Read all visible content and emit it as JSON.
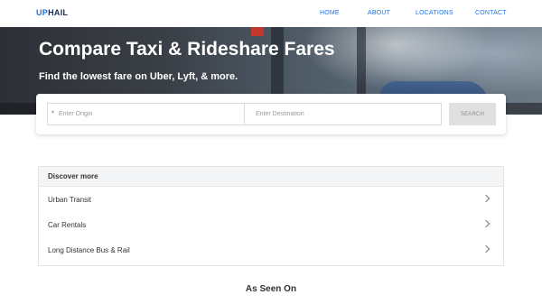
{
  "header": {
    "logo_up": "UP",
    "logo_hail": "HAIL",
    "nav": [
      {
        "label": "HOME"
      },
      {
        "label": "ABOUT"
      },
      {
        "label": "LOCATIONS"
      },
      {
        "label": "CONTACT"
      }
    ]
  },
  "hero": {
    "title": "Compare Taxi & Rideshare Fares",
    "subtitle": "Find the lowest fare on Uber, Lyft, & more."
  },
  "search": {
    "origin_placeholder": "Enter Origin",
    "origin_value": "",
    "destination_placeholder": "Enter Destination",
    "destination_value": "",
    "button_label": "SEARCH",
    "origin_icon": "location-pin-icon"
  },
  "discover": {
    "title": "Discover more",
    "items": [
      {
        "label": "Urban Transit"
      },
      {
        "label": "Car Rentals"
      },
      {
        "label": "Long Distance Bus & Rail"
      }
    ]
  },
  "seen_on": {
    "title": "As Seen On"
  },
  "colors": {
    "brand": "#1a73e8",
    "brand_dark": "#1a2b4a",
    "button_bg": "#e0e0e0"
  }
}
